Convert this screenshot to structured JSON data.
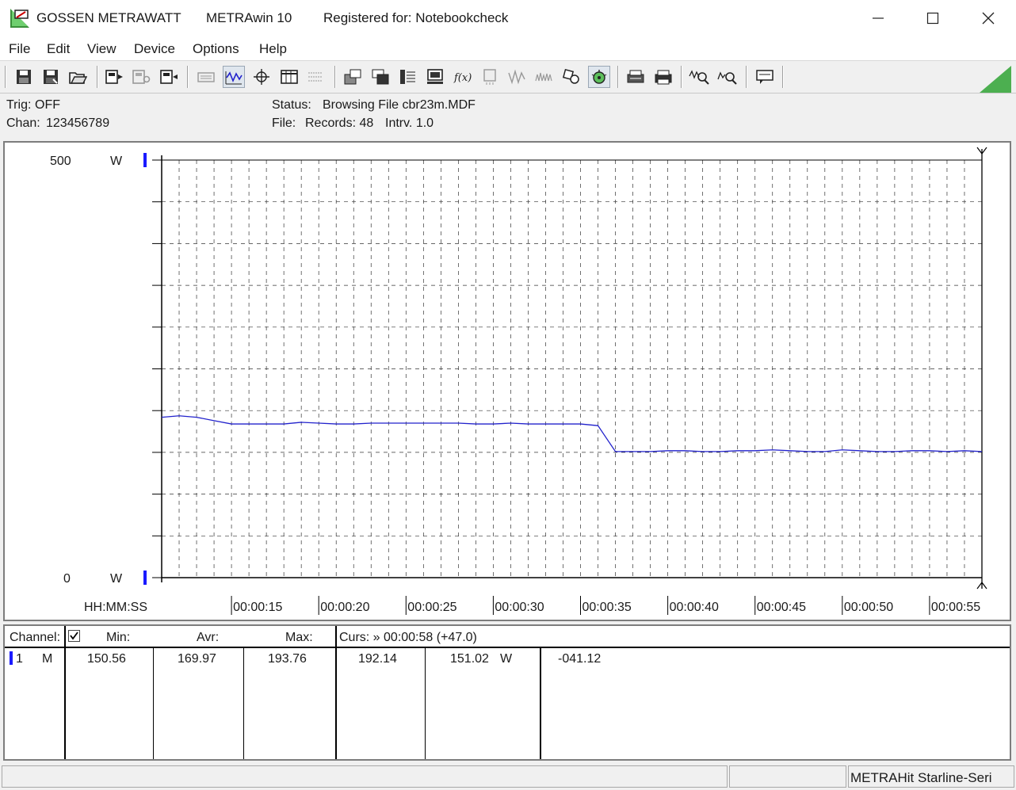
{
  "window": {
    "app_name": "GOSSEN METRAWATT",
    "product": "METRAwin 10",
    "registered": "Registered for: Notebookcheck",
    "icons": [
      "app-logo-icon",
      "minimize-icon",
      "maximize-icon",
      "close-icon"
    ]
  },
  "menu": [
    "File",
    "Edit",
    "View",
    "Device",
    "Options",
    "Help"
  ],
  "info": {
    "trig_label": "Trig:",
    "trig_value": "OFF",
    "chan_label": "Chan:",
    "chan_value": "123456789",
    "status_label": "Status:",
    "status_value": "Browsing File cbr23m.MDF",
    "file_label": "File:",
    "records": "Records: 48",
    "interval": "Intrv. 1.0"
  },
  "colors": {
    "trace": "#2222cc",
    "channel_marker": "#1a1aff",
    "corner_green": "#4caf50"
  },
  "chart_data": {
    "type": "line",
    "y_top_label": "500",
    "y_bottom_label": "0",
    "y_unit_top": "W",
    "y_unit_bottom": "W",
    "ylim": [
      0,
      500
    ],
    "xlim": [
      0,
      47
    ],
    "x_axis_label": "HH:MM:SS",
    "x_tick_labels": [
      "00:00:15",
      "00:00:20",
      "00:00:25",
      "00:00:30",
      "00:00:35",
      "00:00:40",
      "00:00:45",
      "00:00:50",
      "00:00:55"
    ],
    "x_tick_values": [
      4,
      9,
      14,
      19,
      24,
      29,
      34,
      39,
      44
    ],
    "grid": true,
    "series": [
      {
        "values": [
          192,
          193.76,
          192,
          188,
          184,
          184,
          184,
          184,
          186,
          185,
          184,
          184,
          185,
          185,
          185,
          185,
          185,
          185,
          184,
          184,
          185,
          184,
          184,
          184,
          184,
          182,
          151,
          151,
          151,
          152,
          152,
          151,
          151,
          152,
          152,
          153,
          152,
          151,
          151,
          153,
          152,
          151,
          151,
          152,
          152,
          151,
          152,
          151
        ]
      }
    ]
  },
  "table": {
    "headers": {
      "channel": "Channel:",
      "min": "Min:",
      "avr": "Avr:",
      "max": "Max:",
      "curs": "Curs: » 00:00:58 (+47.0)"
    },
    "rows": [
      {
        "num": "1",
        "mode": "M",
        "min": "150.56",
        "avr": "169.97",
        "max": "193.76",
        "c1": "192.14",
        "c2": "151.02",
        "unit": "W",
        "diff": "-041.12"
      }
    ]
  },
  "statusbar": {
    "device": "METRAHit Starline-Seri"
  },
  "toolbar_icons": [
    "save-disk-icon",
    "save-as-icon",
    "open-folder-icon",
    "device-read-icon",
    "device-config-icon",
    "device-transfer-icon",
    "keypad-icon",
    "waveform-view-icon",
    "crosshair-icon",
    "table-view-icon",
    "list-view-icon",
    "export-icon",
    "import-icon",
    "calculator-icon",
    "monitor-icon",
    "function-icon",
    "memory-icon",
    "signal-icon",
    "noise-icon",
    "settings-icon",
    "bug-icon",
    "print-preview-icon",
    "print-icon",
    "zoom-in-icon",
    "zoom-out-icon",
    "comment-icon"
  ]
}
